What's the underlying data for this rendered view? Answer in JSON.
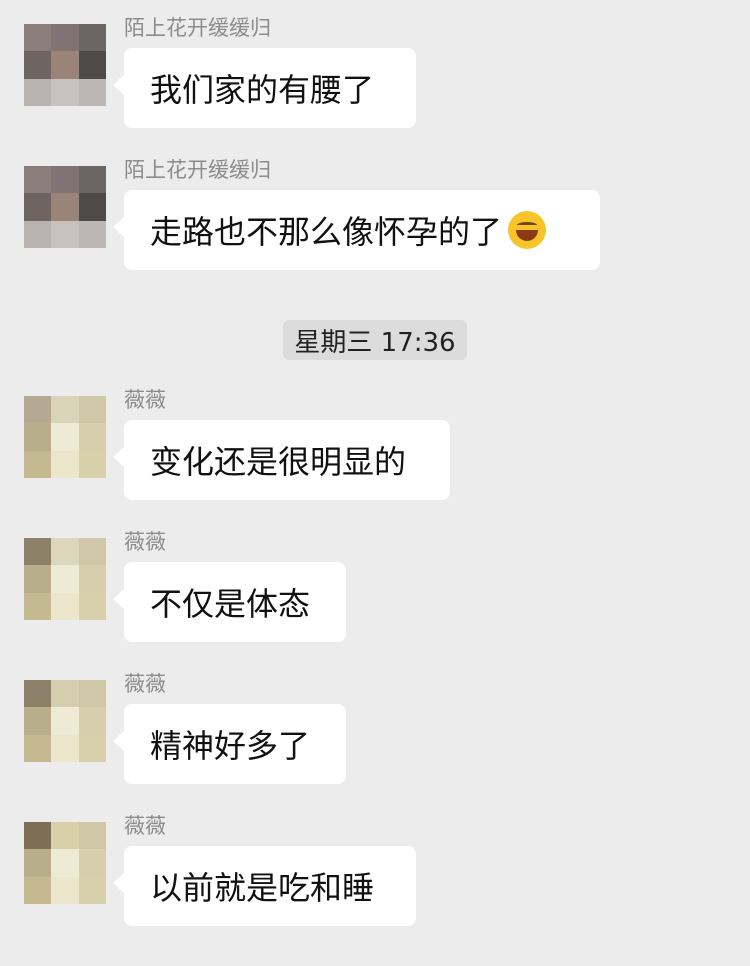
{
  "chat": {
    "time_divider": "星期三 17:36",
    "messages": [
      {
        "sender": "陌上花开缓缓归",
        "text": "我们家的有腰了",
        "emoji": ""
      },
      {
        "sender": "陌上花开缓缓归",
        "text": "走路也不那么像怀孕的了",
        "emoji": "laughing-tears"
      },
      {
        "sender": "薇薇",
        "text": "变化还是很明显的",
        "emoji": ""
      },
      {
        "sender": "薇薇",
        "text": "不仅是体态",
        "emoji": ""
      },
      {
        "sender": "薇薇",
        "text": "精神好多了",
        "emoji": ""
      },
      {
        "sender": "薇薇",
        "text": "以前就是吃和睡",
        "emoji": ""
      }
    ]
  },
  "colors": {
    "background": "#ececec",
    "bubble": "#ffffff",
    "sender_text": "#8c8c8c",
    "timestamp_bg": "#dcdcdc"
  }
}
